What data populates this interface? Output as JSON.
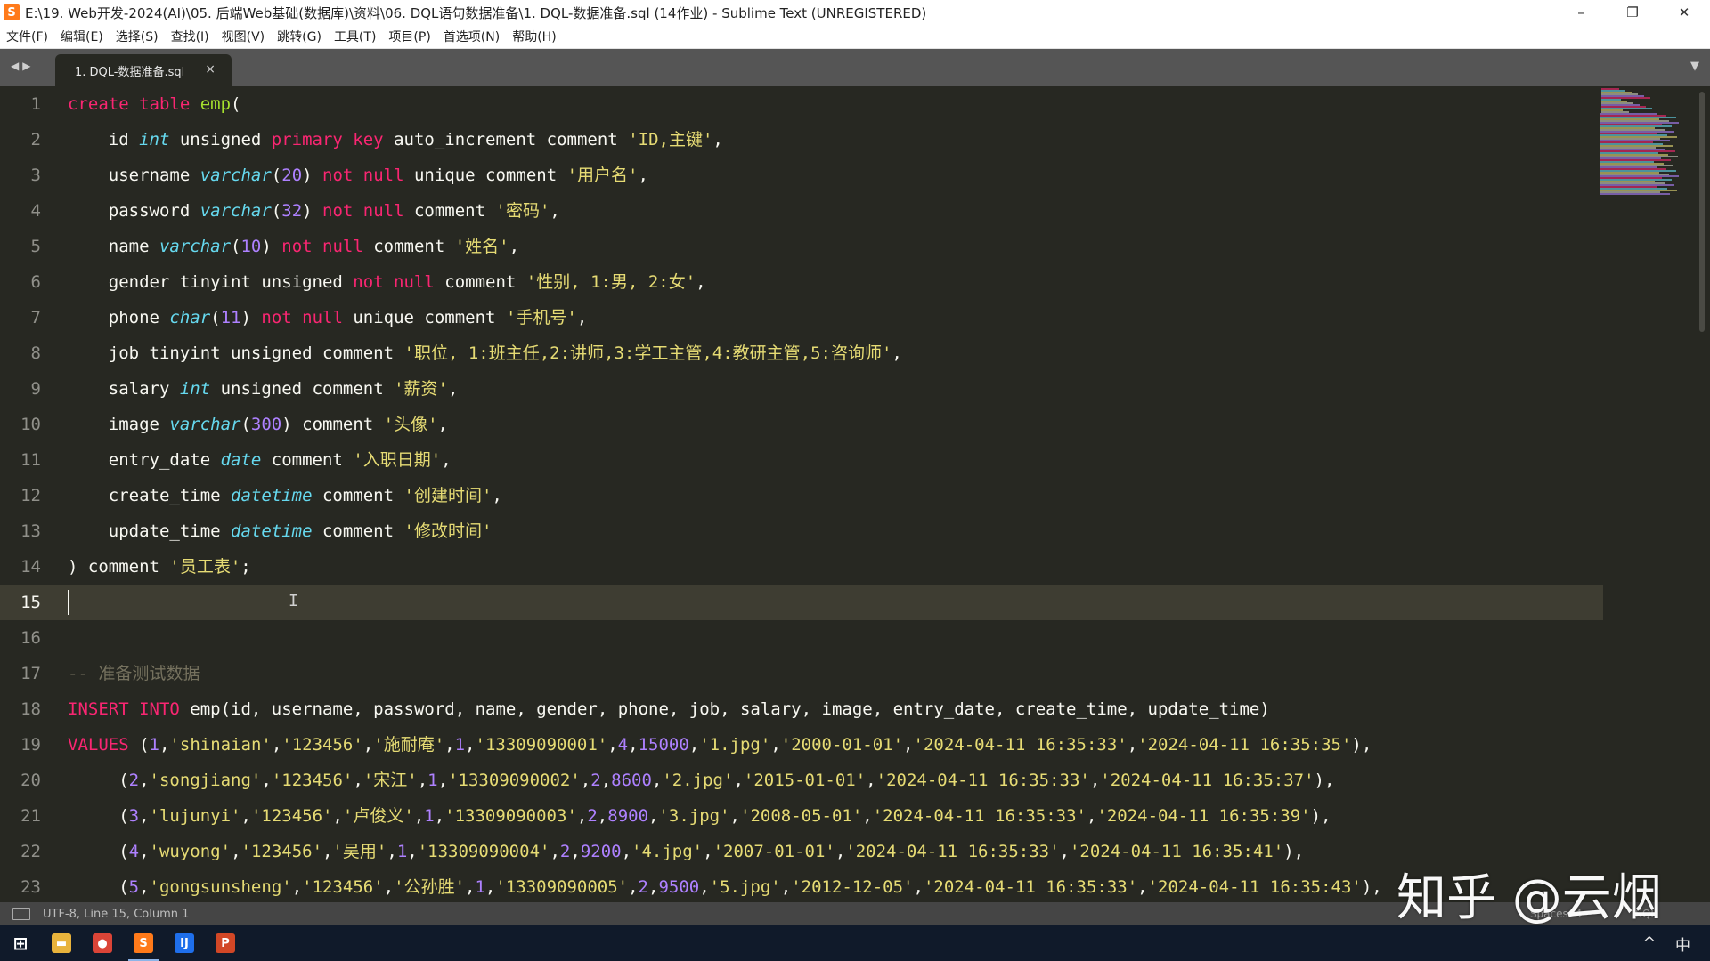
{
  "window": {
    "title": "E:\\19. Web开发-2024(AI)\\05. 后端Web基础(数据库)\\资料\\06. DQL语句数据准备\\1. DQL-数据准备.sql (14作业) - Sublime Text (UNREGISTERED)",
    "minimize_glyph": "–",
    "restore_glyph": "❐",
    "close_glyph": "✕"
  },
  "menu": [
    "文件(F)",
    "编辑(E)",
    "选择(S)",
    "查找(I)",
    "视图(V)",
    "跳转(G)",
    "工具(T)",
    "项目(P)",
    "首选项(N)",
    "帮助(H)"
  ],
  "tabs": [
    {
      "label": "1. DQL-数据准备.sql",
      "close": "×"
    }
  ],
  "editor": {
    "active_line": 15,
    "lines": [
      [
        [
          "kw",
          "create table "
        ],
        [
          "fn",
          "emp"
        ],
        [
          "p",
          "("
        ]
      ],
      [
        [
          "p",
          "    id "
        ],
        [
          "ty",
          "int"
        ],
        [
          "p",
          " unsigned "
        ],
        [
          "kw",
          "primary key"
        ],
        [
          "p",
          " auto_increment comment "
        ],
        [
          "str",
          "'ID,主键'"
        ],
        [
          "p",
          ","
        ]
      ],
      [
        [
          "p",
          "    username "
        ],
        [
          "ty",
          "varchar"
        ],
        [
          "p",
          "("
        ],
        [
          "num",
          "20"
        ],
        [
          "p",
          ") "
        ],
        [
          "kw",
          "not null"
        ],
        [
          "p",
          " unique comment "
        ],
        [
          "str",
          "'用户名'"
        ],
        [
          "p",
          ","
        ]
      ],
      [
        [
          "p",
          "    password "
        ],
        [
          "ty",
          "varchar"
        ],
        [
          "p",
          "("
        ],
        [
          "num",
          "32"
        ],
        [
          "p",
          ") "
        ],
        [
          "kw",
          "not null"
        ],
        [
          "p",
          " comment "
        ],
        [
          "str",
          "'密码'"
        ],
        [
          "p",
          ","
        ]
      ],
      [
        [
          "p",
          "    name "
        ],
        [
          "ty",
          "varchar"
        ],
        [
          "p",
          "("
        ],
        [
          "num",
          "10"
        ],
        [
          "p",
          ") "
        ],
        [
          "kw",
          "not null"
        ],
        [
          "p",
          " comment "
        ],
        [
          "str",
          "'姓名'"
        ],
        [
          "p",
          ","
        ]
      ],
      [
        [
          "p",
          "    gender tinyint unsigned "
        ],
        [
          "kw",
          "not null"
        ],
        [
          "p",
          " comment "
        ],
        [
          "str",
          "'性别, 1:男, 2:女'"
        ],
        [
          "p",
          ","
        ]
      ],
      [
        [
          "p",
          "    phone "
        ],
        [
          "ty",
          "char"
        ],
        [
          "p",
          "("
        ],
        [
          "num",
          "11"
        ],
        [
          "p",
          ") "
        ],
        [
          "kw",
          "not null"
        ],
        [
          "p",
          " unique comment "
        ],
        [
          "str",
          "'手机号'"
        ],
        [
          "p",
          ","
        ]
      ],
      [
        [
          "p",
          "    job tinyint unsigned comment "
        ],
        [
          "str",
          "'职位, 1:班主任,2:讲师,3:学工主管,4:教研主管,5:咨询师'"
        ],
        [
          "p",
          ","
        ]
      ],
      [
        [
          "p",
          "    salary "
        ],
        [
          "ty",
          "int"
        ],
        [
          "p",
          " unsigned comment "
        ],
        [
          "str",
          "'薪资'"
        ],
        [
          "p",
          ","
        ]
      ],
      [
        [
          "p",
          "    image "
        ],
        [
          "ty",
          "varchar"
        ],
        [
          "p",
          "("
        ],
        [
          "num",
          "300"
        ],
        [
          "p",
          ") comment "
        ],
        [
          "str",
          "'头像'"
        ],
        [
          "p",
          ","
        ]
      ],
      [
        [
          "p",
          "    entry_date "
        ],
        [
          "ty",
          "date"
        ],
        [
          "p",
          " comment "
        ],
        [
          "str",
          "'入职日期'"
        ],
        [
          "p",
          ","
        ]
      ],
      [
        [
          "p",
          "    create_time "
        ],
        [
          "ty",
          "datetime"
        ],
        [
          "p",
          " comment "
        ],
        [
          "str",
          "'创建时间'"
        ],
        [
          "p",
          ","
        ]
      ],
      [
        [
          "p",
          "    update_time "
        ],
        [
          "ty",
          "datetime"
        ],
        [
          "p",
          " comment "
        ],
        [
          "str",
          "'修改时间'"
        ]
      ],
      [
        [
          "p",
          ") comment "
        ],
        [
          "str",
          "'员工表'"
        ],
        [
          "p",
          ";"
        ]
      ],
      [],
      [],
      [
        [
          "cmt",
          "-- 准备测试数据"
        ]
      ],
      [
        [
          "kw",
          "INSERT INTO"
        ],
        [
          "p",
          " emp(id, username, password, name, gender, phone, job, salary, image, entry_date, create_time, update_time)"
        ]
      ],
      [
        [
          "kw",
          "VALUES"
        ],
        [
          "p",
          " ("
        ],
        [
          "num",
          "1"
        ],
        [
          "p",
          ","
        ],
        [
          "str",
          "'shinaian'"
        ],
        [
          "p",
          ","
        ],
        [
          "str",
          "'123456'"
        ],
        [
          "p",
          ","
        ],
        [
          "str",
          "'施耐庵'"
        ],
        [
          "p",
          ","
        ],
        [
          "num",
          "1"
        ],
        [
          "p",
          ","
        ],
        [
          "str",
          "'13309090001'"
        ],
        [
          "p",
          ","
        ],
        [
          "num",
          "4"
        ],
        [
          "p",
          ","
        ],
        [
          "num",
          "15000"
        ],
        [
          "p",
          ","
        ],
        [
          "str",
          "'1.jpg'"
        ],
        [
          "p",
          ","
        ],
        [
          "str",
          "'2000-01-01'"
        ],
        [
          "p",
          ","
        ],
        [
          "str",
          "'2024-04-11 16:35:33'"
        ],
        [
          "p",
          ","
        ],
        [
          "str",
          "'2024-04-11 16:35:35'"
        ],
        [
          "p",
          "),"
        ]
      ],
      [
        [
          "p",
          "     ("
        ],
        [
          "num",
          "2"
        ],
        [
          "p",
          ","
        ],
        [
          "str",
          "'songjiang'"
        ],
        [
          "p",
          ","
        ],
        [
          "str",
          "'123456'"
        ],
        [
          "p",
          ","
        ],
        [
          "str",
          "'宋江'"
        ],
        [
          "p",
          ","
        ],
        [
          "num",
          "1"
        ],
        [
          "p",
          ","
        ],
        [
          "str",
          "'13309090002'"
        ],
        [
          "p",
          ","
        ],
        [
          "num",
          "2"
        ],
        [
          "p",
          ","
        ],
        [
          "num",
          "8600"
        ],
        [
          "p",
          ","
        ],
        [
          "str",
          "'2.jpg'"
        ],
        [
          "p",
          ","
        ],
        [
          "str",
          "'2015-01-01'"
        ],
        [
          "p",
          ","
        ],
        [
          "str",
          "'2024-04-11 16:35:33'"
        ],
        [
          "p",
          ","
        ],
        [
          "str",
          "'2024-04-11 16:35:37'"
        ],
        [
          "p",
          "),"
        ]
      ],
      [
        [
          "p",
          "     ("
        ],
        [
          "num",
          "3"
        ],
        [
          "p",
          ","
        ],
        [
          "str",
          "'lujunyi'"
        ],
        [
          "p",
          ","
        ],
        [
          "str",
          "'123456'"
        ],
        [
          "p",
          ","
        ],
        [
          "str",
          "'卢俊义'"
        ],
        [
          "p",
          ","
        ],
        [
          "num",
          "1"
        ],
        [
          "p",
          ","
        ],
        [
          "str",
          "'13309090003'"
        ],
        [
          "p",
          ","
        ],
        [
          "num",
          "2"
        ],
        [
          "p",
          ","
        ],
        [
          "num",
          "8900"
        ],
        [
          "p",
          ","
        ],
        [
          "str",
          "'3.jpg'"
        ],
        [
          "p",
          ","
        ],
        [
          "str",
          "'2008-05-01'"
        ],
        [
          "p",
          ","
        ],
        [
          "str",
          "'2024-04-11 16:35:33'"
        ],
        [
          "p",
          ","
        ],
        [
          "str",
          "'2024-04-11 16:35:39'"
        ],
        [
          "p",
          "),"
        ]
      ],
      [
        [
          "p",
          "     ("
        ],
        [
          "num",
          "4"
        ],
        [
          "p",
          ","
        ],
        [
          "str",
          "'wuyong'"
        ],
        [
          "p",
          ","
        ],
        [
          "str",
          "'123456'"
        ],
        [
          "p",
          ","
        ],
        [
          "str",
          "'吴用'"
        ],
        [
          "p",
          ","
        ],
        [
          "num",
          "1"
        ],
        [
          "p",
          ","
        ],
        [
          "str",
          "'13309090004'"
        ],
        [
          "p",
          ","
        ],
        [
          "num",
          "2"
        ],
        [
          "p",
          ","
        ],
        [
          "num",
          "9200"
        ],
        [
          "p",
          ","
        ],
        [
          "str",
          "'4.jpg'"
        ],
        [
          "p",
          ","
        ],
        [
          "str",
          "'2007-01-01'"
        ],
        [
          "p",
          ","
        ],
        [
          "str",
          "'2024-04-11 16:35:33'"
        ],
        [
          "p",
          ","
        ],
        [
          "str",
          "'2024-04-11 16:35:41'"
        ],
        [
          "p",
          "),"
        ]
      ],
      [
        [
          "p",
          "     ("
        ],
        [
          "num",
          "5"
        ],
        [
          "p",
          ","
        ],
        [
          "str",
          "'gongsunsheng'"
        ],
        [
          "p",
          ","
        ],
        [
          "str",
          "'123456'"
        ],
        [
          "p",
          ","
        ],
        [
          "str",
          "'公孙胜'"
        ],
        [
          "p",
          ","
        ],
        [
          "num",
          "1"
        ],
        [
          "p",
          ","
        ],
        [
          "str",
          "'13309090005'"
        ],
        [
          "p",
          ","
        ],
        [
          "num",
          "2"
        ],
        [
          "p",
          ","
        ],
        [
          "num",
          "9500"
        ],
        [
          "p",
          ","
        ],
        [
          "str",
          "'5.jpg'"
        ],
        [
          "p",
          ","
        ],
        [
          "str",
          "'2012-12-05'"
        ],
        [
          "p",
          ","
        ],
        [
          "str",
          "'2024-04-11 16:35:33'"
        ],
        [
          "p",
          ","
        ],
        [
          "str",
          "'2024-04-11 16:35:43'"
        ],
        [
          "p",
          "),"
        ]
      ]
    ]
  },
  "status": {
    "left": "UTF-8, Line 15, Column 1",
    "spaces": "Spaces: 4",
    "syntax": "SQL"
  },
  "taskbar": {
    "apps": [
      {
        "name": "windows-start-icon",
        "glyph": "⊞",
        "color": "#101a2a"
      },
      {
        "name": "file-explorer-icon",
        "glyph": "▬",
        "color": "#e8b33c"
      },
      {
        "name": "chrome-icon",
        "glyph": "●",
        "color": "#db4437"
      },
      {
        "name": "sublime-text-icon",
        "glyph": "S",
        "color": "#ff7a1a"
      },
      {
        "name": "intellij-icon",
        "glyph": "IJ",
        "color": "#1f6feb"
      },
      {
        "name": "powerpoint-icon",
        "glyph": "P",
        "color": "#d24726"
      }
    ],
    "chevron": "^",
    "ime": "中"
  },
  "watermark": "知乎 @云烟",
  "colors": {
    "keyword": "#f92672",
    "type": "#66d9ef",
    "function": "#a6e22e",
    "string": "#e6db74",
    "number": "#ae81ff",
    "comment": "#75715e",
    "background": "#272822"
  }
}
